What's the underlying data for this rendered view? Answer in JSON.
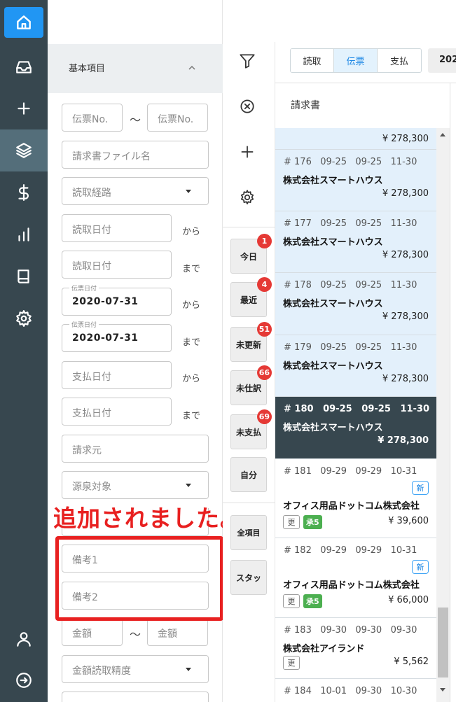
{
  "nav": {
    "items": [
      {
        "name": "home",
        "icon": "home-icon"
      },
      {
        "name": "inbox",
        "icon": "inbox-icon"
      },
      {
        "name": "add",
        "icon": "plus-icon"
      },
      {
        "name": "layers",
        "icon": "layers-icon"
      },
      {
        "name": "payment",
        "icon": "dollar-icon"
      },
      {
        "name": "reports",
        "icon": "bar-chart-icon"
      },
      {
        "name": "book",
        "icon": "book-icon"
      },
      {
        "name": "settings",
        "icon": "gear-icon"
      },
      {
        "name": "user",
        "icon": "user-icon"
      },
      {
        "name": "logout",
        "icon": "arrow-right-circle-icon"
      }
    ],
    "active": "layers",
    "accent": "#2196f3"
  },
  "filter": {
    "section_title": "基本項目",
    "slip_no_from_ph": "伝票No.",
    "slip_no_to_ph": "伝票No.",
    "tilde": "〜",
    "invoice_file_ph": "請求書ファイル名",
    "read_route_ph": "読取経路",
    "read_date_from_ph": "読取日付",
    "read_date_to_ph": "読取日付",
    "suffix_from": "から",
    "suffix_to": "まで",
    "slip_date_label": "伝票日付",
    "slip_date_from": "2020-07-31",
    "slip_date_to": "2020-07-31",
    "pay_date_from_ph": "支払日付",
    "pay_date_to_ph": "支払日付",
    "biller_ph": "請求元",
    "withholding_ph": "源泉対象",
    "note1_ph": "備考1",
    "note2_ph": "備考2",
    "amount_from_ph": "金額",
    "amount_to_ph": "金額",
    "amount_accuracy_ph": "金額読取精度"
  },
  "annotation": {
    "text": "追加されました。",
    "color": "#e82020"
  },
  "toolbar": {
    "icons": [
      "filter-icon",
      "clear-icon",
      "plus-icon",
      "gear-icon"
    ],
    "quick": [
      {
        "label": "今日",
        "badge": "1"
      },
      {
        "label": "最近",
        "badge": "4"
      },
      {
        "label": "未更新",
        "badge": "51"
      },
      {
        "label": "未仕訳",
        "badge": "66"
      },
      {
        "label": "未支払",
        "badge": "69"
      },
      {
        "label": "自分",
        "badge": ""
      }
    ],
    "all_items": "全項目",
    "staff": "スタッ"
  },
  "list": {
    "tabs": [
      "読取",
      "伝票",
      "支払"
    ],
    "active_tab": "伝票",
    "year_btn": "202",
    "title": "請求書",
    "records": [
      {
        "meta": "",
        "name": "",
        "amount": "¥ 278,300",
        "style": "blue"
      },
      {
        "meta": "# 176   09-25   09-25   11-30",
        "name": "株式会社スマートハウス",
        "amount": "¥ 278,300",
        "style": "blue"
      },
      {
        "meta": "# 177   09-25   09-25   11-30",
        "name": "株式会社スマートハウス",
        "amount": "¥ 278,300",
        "style": "blue"
      },
      {
        "meta": "# 178   09-25   09-25   11-30",
        "name": "株式会社スマートハウス",
        "amount": "¥ 278,300",
        "style": "blue"
      },
      {
        "meta": "# 179   09-25   09-25   11-30",
        "name": "株式会社スマートハウス",
        "amount": "¥ 278,300",
        "style": "blue"
      },
      {
        "meta": "# 180   09-25   09-25   11-30",
        "name": "株式会社スマートハウス",
        "amount": "¥ 278,300",
        "style": "dark"
      },
      {
        "meta": "# 181   09-29   09-29   10-31",
        "name": "オフィス用品ドットコム株式会社",
        "amount": "¥ 39,600",
        "style": "white",
        "new": "新",
        "upd": "更",
        "ok": "承5"
      },
      {
        "meta": "# 182   09-29   09-29   10-31",
        "name": "オフィス用品ドットコム株式会社",
        "amount": "¥ 66,000",
        "style": "white",
        "new": "新",
        "upd": "更",
        "ok": "承5"
      },
      {
        "meta": "# 183   09-30   09-30   09-30",
        "name": "株式会社アイランド",
        "amount": "¥ 5,562",
        "style": "white",
        "upd": "更"
      },
      {
        "meta": "# 184   10-01   09-30   10-30",
        "name": "",
        "amount": "",
        "style": "white"
      }
    ]
  }
}
